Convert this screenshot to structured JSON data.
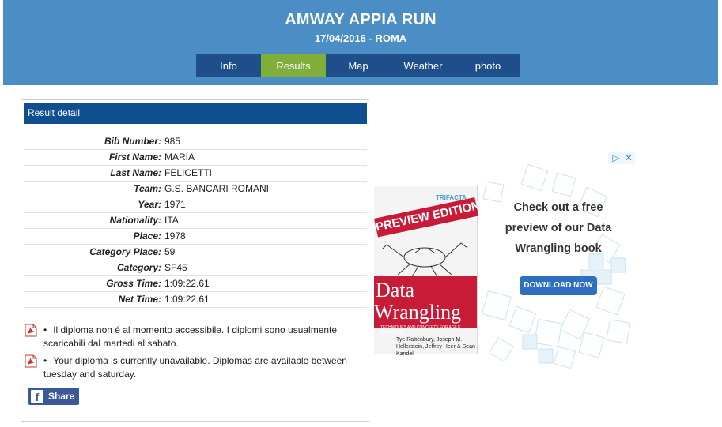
{
  "event": {
    "title": "AMWAY APPIA RUN",
    "subtitle": "17/04/2016 - ROMA"
  },
  "nav": {
    "tabs": [
      {
        "label": "Info",
        "active": false
      },
      {
        "label": "Results",
        "active": true
      },
      {
        "label": "Map",
        "active": false
      },
      {
        "label": "Weather",
        "active": false
      },
      {
        "label": "photo",
        "active": false
      }
    ]
  },
  "result": {
    "heading": "Result detail",
    "rows": [
      {
        "label": "Bib Number:",
        "value": "985"
      },
      {
        "label": "First Name:",
        "value": "MARIA"
      },
      {
        "label": "Last Name:",
        "value": "FELICETTI"
      },
      {
        "label": "Team:",
        "value": "G.S. BANCARI ROMANI"
      },
      {
        "label": "Year:",
        "value": "1971"
      },
      {
        "label": "Nationality:",
        "value": "ITA"
      },
      {
        "label": "Place:",
        "value": "1978"
      },
      {
        "label": "Category Place:",
        "value": "59"
      },
      {
        "label": "Category:",
        "value": "SF45"
      },
      {
        "label": "Gross Time:",
        "value": "1:09:22.61"
      },
      {
        "label": "Net Time:",
        "value": "1:09:22.61"
      }
    ]
  },
  "notices": {
    "bullet": "•",
    "it": "Il diploma non é al momento accessibile. I diplomi sono usualmente scaricabili dal martedi al sabato.",
    "en": "Your diploma is currently unavailable. Diplomas are available between tuesday and saturday."
  },
  "share": {
    "label": "Share",
    "icon": "f"
  },
  "ad": {
    "copy_line1": "Check out a free",
    "copy_line2": "preview of our Data",
    "copy_line3": "Wrangling book",
    "button": "DOWNLOAD NOW",
    "book_logo": "TRIFACTA",
    "book_preview": "PREVIEW EDITION",
    "book_title_1": "Data",
    "book_title_2": "Wrangling",
    "book_tagline": "TECHNIQUES AND CONCEPTS FOR AGILE ANALYTICS",
    "book_authors": "Tye Rattenbury, Joseph M. Hellerstein, Jeffrey Heer & Sean Kandel",
    "choices_icon": "▷",
    "close_icon": "✕"
  },
  "colors": {
    "header": "#4a8ec5",
    "nav": "#1e4f8a",
    "nav_active": "#7fae3a",
    "panel_head": "#0f4f90",
    "facebook": "#3b5998",
    "ad_red": "#c81b37",
    "ad_button": "#2f6fc0"
  }
}
